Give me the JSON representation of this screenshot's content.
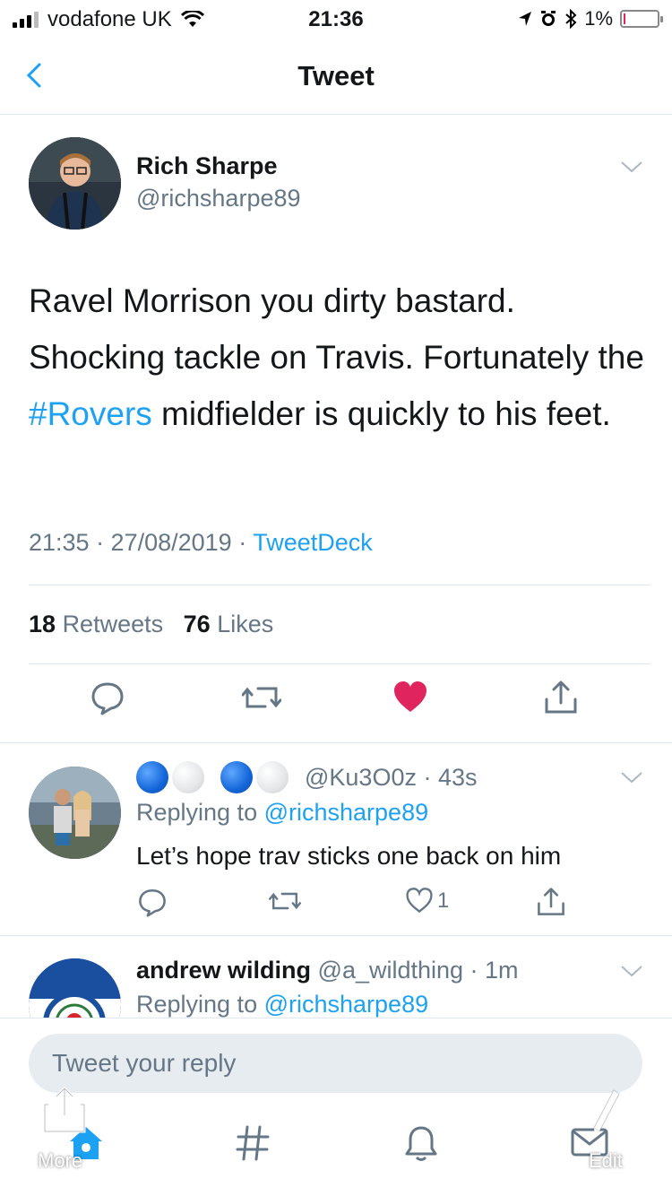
{
  "status_bar": {
    "carrier": "vodafone UK",
    "time": "21:36",
    "battery_pct": "1%"
  },
  "nav": {
    "title": "Tweet"
  },
  "tweet": {
    "author_name": "Rich Sharpe",
    "author_handle": "@richsharpe89",
    "text_before": "Ravel Morrison you dirty bastard. Shocking tackle on Travis. Fortunately the ",
    "hashtag": "#Rovers",
    "text_after": " midfielder is quickly to his feet.",
    "timestamp": "21:35 · 27/08/2019 · ",
    "source": "TweetDeck",
    "retweets_count": "18",
    "retweets_label": "Retweets",
    "likes_count": "76",
    "likes_label": "Likes",
    "liked": true
  },
  "replies": [
    {
      "handle_time": "@Ku3O0z · 43s",
      "replying_prefix": "Replying to ",
      "replying_to": "@richsharpe89",
      "text": "Let’s hope trav sticks one back on him",
      "like_count": "1"
    },
    {
      "name": "andrew wilding",
      "handle_time": "@a_wildthing · 1m",
      "replying_prefix": "Replying to ",
      "replying_to": "@richsharpe89"
    }
  ],
  "reply_bar": {
    "placeholder": "Tweet your reply"
  },
  "overlay": {
    "more_label": "More",
    "edit_label": "Edit"
  },
  "colors": {
    "accent": "#1da1f2",
    "like": "#e0245e",
    "muted": "#657786"
  }
}
